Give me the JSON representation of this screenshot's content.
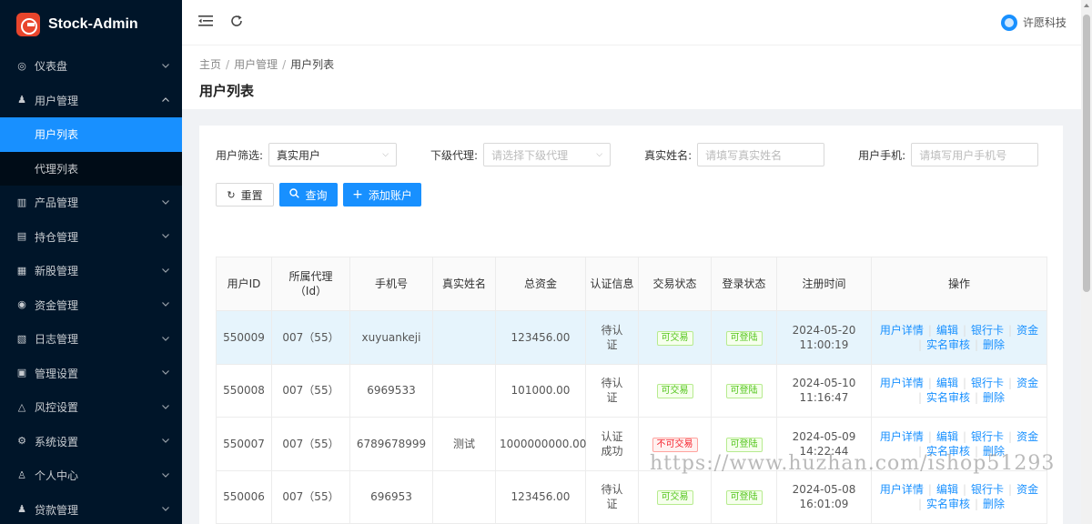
{
  "app": {
    "title": "Stock-Admin"
  },
  "sidebar": {
    "items": [
      {
        "label": "仪表盘",
        "icon": "dashboard-icon",
        "glyph": "◎",
        "expanded": false
      },
      {
        "label": "用户管理",
        "icon": "users-icon",
        "glyph": "♟",
        "expanded": true,
        "children": [
          {
            "label": "用户列表",
            "active": true
          },
          {
            "label": "代理列表",
            "active": false
          }
        ]
      },
      {
        "label": "产品管理",
        "icon": "chart-icon",
        "glyph": "▥",
        "expanded": false
      },
      {
        "label": "持仓管理",
        "icon": "position-icon",
        "glyph": "▤",
        "expanded": false
      },
      {
        "label": "新股管理",
        "icon": "ipo-icon",
        "glyph": "▦",
        "expanded": false
      },
      {
        "label": "资金管理",
        "icon": "money-icon",
        "glyph": "◉",
        "expanded": false
      },
      {
        "label": "日志管理",
        "icon": "log-icon",
        "glyph": "▧",
        "expanded": false
      },
      {
        "label": "管理设置",
        "icon": "settings-grid-icon",
        "glyph": "▣",
        "expanded": false
      },
      {
        "label": "风控设置",
        "icon": "warning-icon",
        "glyph": "△",
        "expanded": false
      },
      {
        "label": "系统设置",
        "icon": "gear-icon",
        "glyph": "⚙",
        "expanded": false
      },
      {
        "label": "个人中心",
        "icon": "person-icon",
        "glyph": "♙",
        "expanded": false
      },
      {
        "label": "贷款管理",
        "icon": "loan-icon",
        "glyph": "♟",
        "expanded": false
      }
    ]
  },
  "header": {
    "company": "许愿科技"
  },
  "breadcrumb": {
    "items": [
      "主页",
      "用户管理",
      "用户列表"
    ]
  },
  "page": {
    "title": "用户列表"
  },
  "filters": {
    "user_filter_label": "用户筛选:",
    "user_filter_value": "真实用户",
    "agent_label": "下级代理:",
    "agent_placeholder": "请选择下级代理",
    "name_label": "真实姓名:",
    "name_placeholder": "请填写真实姓名",
    "phone_label": "用户手机:",
    "phone_placeholder": "请填写用户手机号"
  },
  "buttons": {
    "reset": "重置",
    "search": "查询",
    "add": "添加账户"
  },
  "table": {
    "headers": [
      "用户ID",
      "所属代理（Id）",
      "手机号",
      "真实姓名",
      "总资金",
      "认证信息",
      "交易状态",
      "登录状态",
      "注册时间",
      "操作"
    ],
    "rows": [
      {
        "id": "550009",
        "agent": "007（55）",
        "phone": "xuyuankeji",
        "name": "",
        "funds": "123456.00",
        "auth": "待认证",
        "trade": "可交易",
        "trade_ok": true,
        "login": "可登陆",
        "reg_date": "2024-05-20",
        "reg_time": "11:00:19",
        "highlight": true
      },
      {
        "id": "550008",
        "agent": "007（55）",
        "phone": "6969533",
        "name": "",
        "funds": "101000.00",
        "auth": "待认证",
        "trade": "可交易",
        "trade_ok": true,
        "login": "可登陆",
        "reg_date": "2024-05-10",
        "reg_time": "11:16:47",
        "highlight": false
      },
      {
        "id": "550007",
        "agent": "007（55）",
        "phone": "6789678999",
        "name": "测试",
        "funds": "1000000000.00",
        "auth": "认证成功",
        "trade": "不可交易",
        "trade_ok": false,
        "login": "可登陆",
        "reg_date": "2024-05-09",
        "reg_time": "14:22:44",
        "highlight": false
      },
      {
        "id": "550006",
        "agent": "007（55）",
        "phone": "696953",
        "name": "",
        "funds": "123456.00",
        "auth": "待认证",
        "trade": "可交易",
        "trade_ok": true,
        "login": "可登陆",
        "reg_date": "2024-05-08",
        "reg_time": "16:01:09",
        "highlight": false
      }
    ],
    "actions": {
      "detail": "用户详情",
      "edit": "编辑",
      "bank": "银行卡",
      "funds": "资金",
      "verify": "实名审核",
      "delete": "删除"
    }
  },
  "watermark": "https://www.huzhan.com/ishop51293"
}
